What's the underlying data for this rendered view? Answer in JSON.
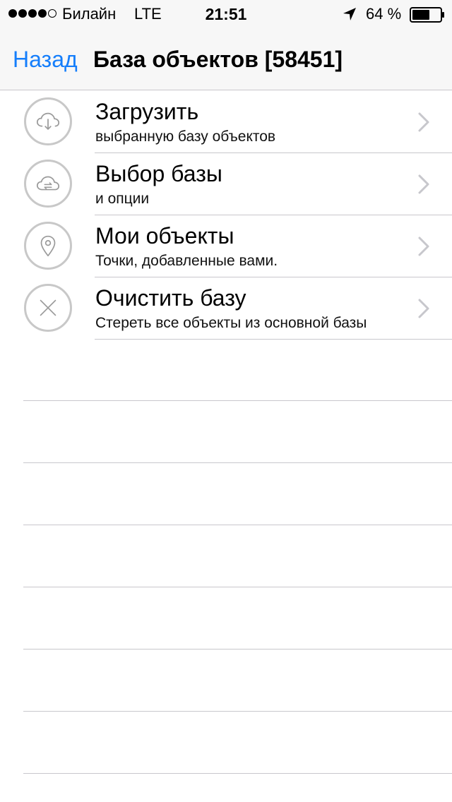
{
  "status_bar": {
    "signal_dots": [
      true,
      true,
      true,
      true,
      false
    ],
    "carrier": "Билайн",
    "network": "LTE",
    "time": "21:51",
    "battery_percent": "64 %",
    "battery_level": 0.64,
    "icons": [
      "location-arrow-icon",
      "battery-icon"
    ]
  },
  "nav": {
    "back_label": "Назад",
    "title": "База объектов [58451]",
    "accent_color": "#157efb"
  },
  "menu": {
    "items": [
      {
        "title": "Загрузить",
        "subtitle": "выбранную базу объектов",
        "icon": "cloud-download-icon"
      },
      {
        "title": "Выбор базы",
        "subtitle": "и опции",
        "icon": "cloud-sync-icon"
      },
      {
        "title": "Мои объекты",
        "subtitle": "Точки, добавленные вами.",
        "icon": "map-pin-icon"
      },
      {
        "title": "Очистить базу",
        "subtitle": "Стереть все объекты из основной базы",
        "icon": "close-icon"
      }
    ]
  }
}
